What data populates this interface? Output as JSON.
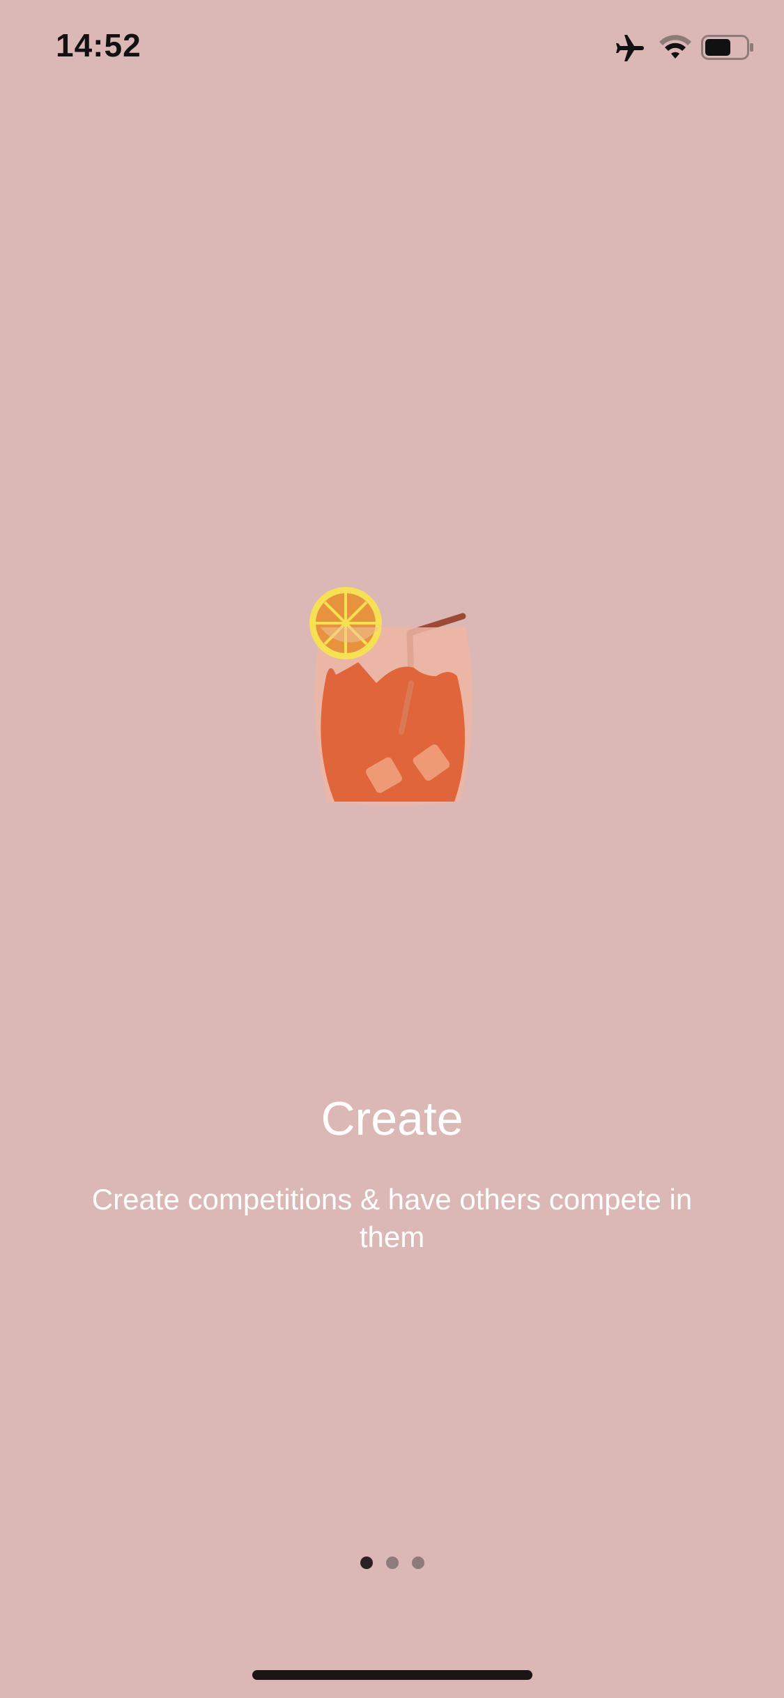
{
  "status_bar": {
    "time": "14:52",
    "icons": [
      "airplane-icon",
      "wifi-icon",
      "battery-icon"
    ]
  },
  "illustration": {
    "icon": "cocktail-icon"
  },
  "onboarding": {
    "title": "Create",
    "subtitle": "Create competitions & have others compete in them"
  },
  "pagination": {
    "total": 3,
    "current": 1
  },
  "colors": {
    "background": "#dbb8b6",
    "drink": "#e0653b",
    "lemon": "#f6e054",
    "straw": "#9c4a35",
    "text": "#ffffff"
  }
}
